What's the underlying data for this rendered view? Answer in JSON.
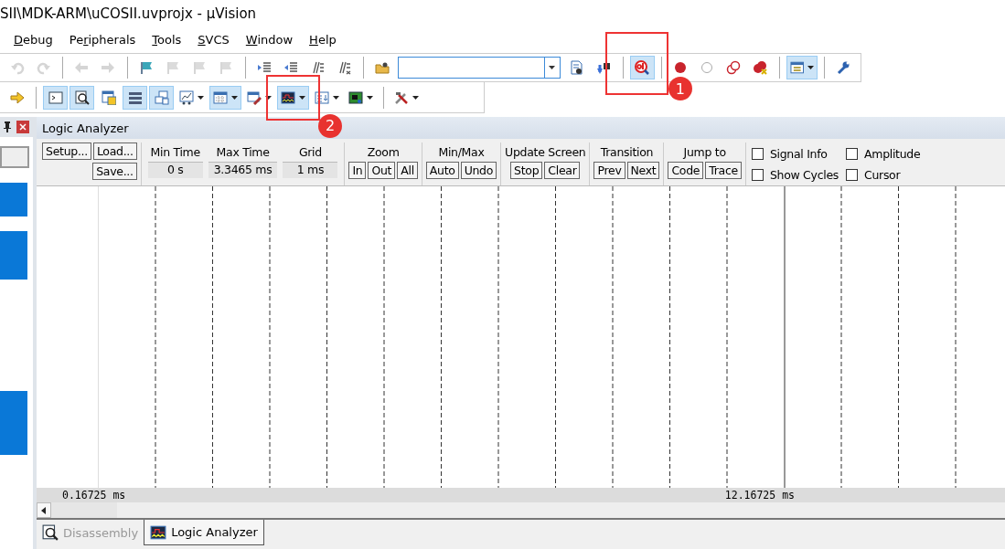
{
  "window": {
    "title": "SII\\MDK-ARM\\uCOSII.uvprojx - µVision"
  },
  "menu": [
    {
      "label": "Debug"
    },
    {
      "label": "Peripherals"
    },
    {
      "label": "Tools"
    },
    {
      "label": "SVCS"
    },
    {
      "label": "Window"
    },
    {
      "label": "Help"
    }
  ],
  "toolbar_1": [
    {
      "kind": "button",
      "disabled": true
    },
    {
      "kind": "button",
      "disabled": true
    },
    {
      "kind": "separator"
    },
    {
      "kind": "button",
      "disabled": true
    },
    {
      "kind": "button",
      "disabled": true
    },
    {
      "kind": "separator"
    },
    {
      "kind": "button",
      "disabled": false
    },
    {
      "kind": "button",
      "disabled": true
    },
    {
      "kind": "button",
      "disabled": true
    },
    {
      "kind": "button",
      "disabled": true
    },
    {
      "kind": "separator"
    },
    {
      "kind": "button",
      "disabled": false
    },
    {
      "kind": "button",
      "disabled": false
    },
    {
      "kind": "button",
      "disabled": false
    },
    {
      "kind": "button",
      "disabled": false
    },
    {
      "kind": "separator"
    },
    {
      "kind": "button",
      "disabled": false
    },
    {
      "kind": "field"
    },
    {
      "kind": "button",
      "disabled": false
    },
    {
      "kind": "button",
      "disabled": false
    },
    {
      "kind": "separator"
    },
    {
      "kind": "button",
      "pressed": true
    },
    {
      "kind": "separator"
    },
    {
      "kind": "button",
      "disabled": false
    },
    {
      "kind": "button",
      "disabled": false
    },
    {
      "kind": "button",
      "disabled": false
    },
    {
      "kind": "button",
      "disabled": false
    },
    {
      "kind": "separator"
    },
    {
      "kind": "dropdown",
      "pressed": true
    },
    {
      "kind": "separator"
    },
    {
      "kind": "button",
      "disabled": false
    }
  ],
  "toolbar_2": [
    {
      "kind": "button",
      "pressed": false
    },
    {
      "kind": "separator"
    },
    {
      "kind": "button",
      "pressed": true
    },
    {
      "kind": "button",
      "pressed": true
    },
    {
      "kind": "button",
      "pressed": false
    },
    {
      "kind": "button",
      "pressed": true
    },
    {
      "kind": "button",
      "pressed": true
    },
    {
      "kind": "dropdown",
      "pressed": false
    },
    {
      "kind": "dropdown",
      "pressed": true
    },
    {
      "kind": "dropdown",
      "pressed": false
    },
    {
      "kind": "dropdown",
      "pressed": true
    },
    {
      "kind": "dropdown",
      "pressed": false
    },
    {
      "kind": "dropdown",
      "pressed": false
    },
    {
      "kind": "separator"
    },
    {
      "kind": "dropdown",
      "pressed": false
    }
  ],
  "callouts": [
    {
      "label": "1"
    },
    {
      "label": "2"
    }
  ],
  "panel": {
    "title": "Logic Analyzer"
  },
  "controls": {
    "setup": "Setup...",
    "load": "Load...",
    "save": "Save...",
    "readouts": [
      {
        "label": "Min Time",
        "value": "0 s"
      },
      {
        "label": "Max Time",
        "value": "3.3465 ms"
      },
      {
        "label": "Grid",
        "value": "1 ms"
      }
    ],
    "groups": [
      {
        "title": "Zoom",
        "buttons": [
          "In",
          "Out",
          "All"
        ]
      },
      {
        "title": "Min/Max",
        "buttons": [
          "Auto",
          "Undo"
        ]
      },
      {
        "title": "Update Screen",
        "buttons": [
          "Stop",
          "Clear"
        ]
      },
      {
        "title": "Transition",
        "buttons": [
          "Prev",
          "Next"
        ]
      },
      {
        "title": "Jump to",
        "buttons": [
          "Code",
          "Trace"
        ]
      }
    ],
    "checkboxes": [
      {
        "label": "Signal Info",
        "checked": false
      },
      {
        "label": "Amplitude",
        "checked": false
      },
      {
        "label": "Show Cycles",
        "checked": false
      },
      {
        "label": "Cursor",
        "checked": false
      }
    ]
  },
  "plot": {
    "time_start": "0.16725 ms",
    "time_end": "12.16725 ms"
  },
  "tabs": [
    {
      "label": "Disassembly",
      "selected": false
    },
    {
      "label": "Logic Analyzer",
      "selected": true
    }
  ]
}
